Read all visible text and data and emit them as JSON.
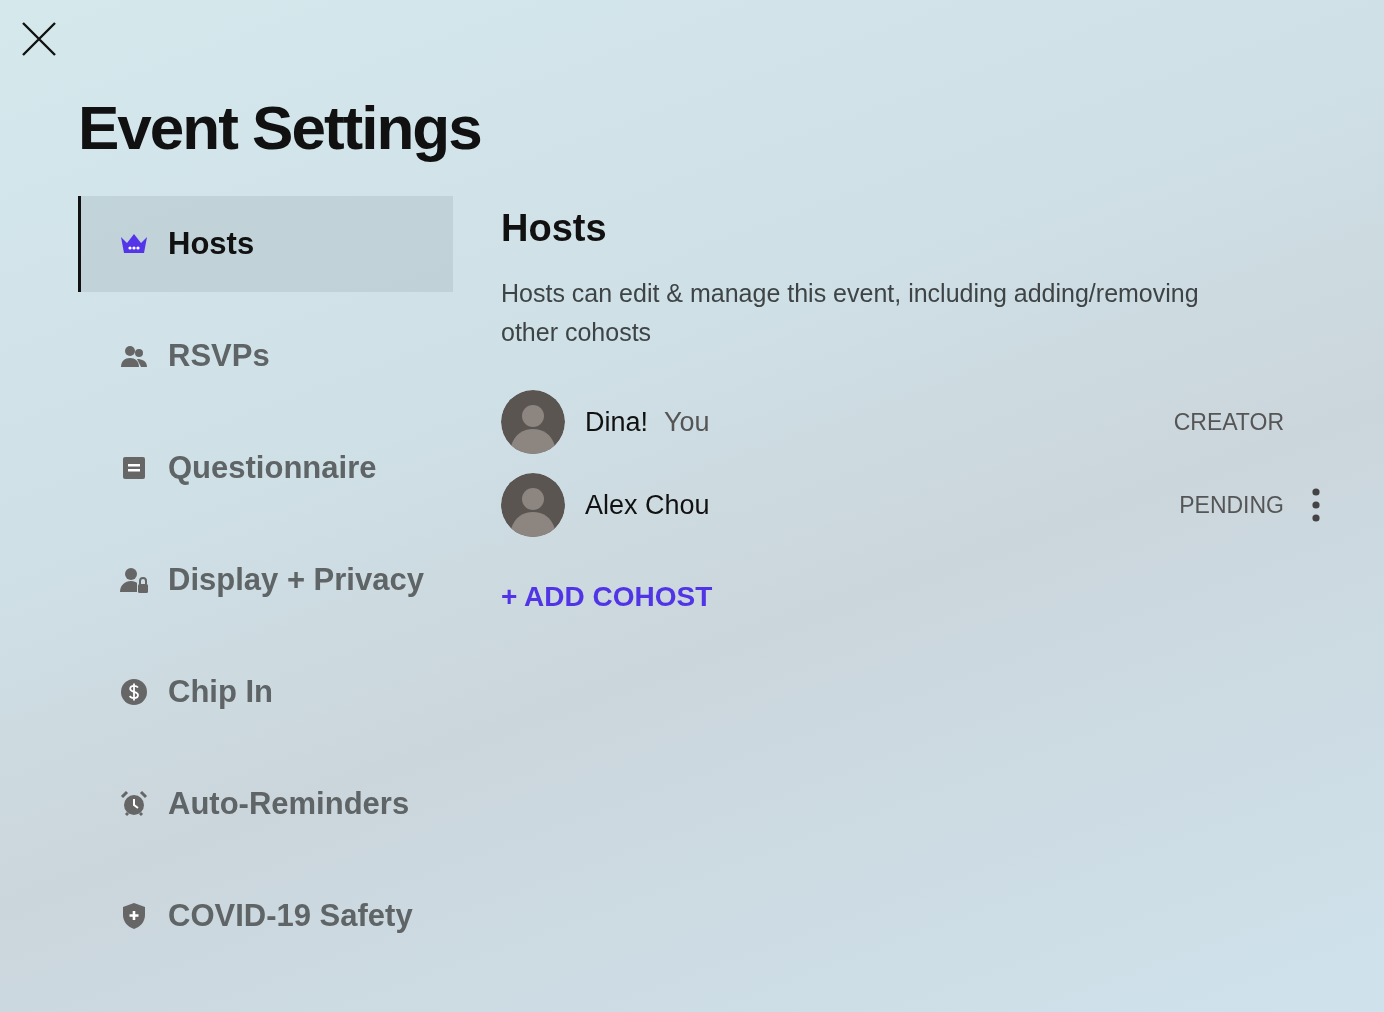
{
  "title": "Event Settings",
  "sidebar": {
    "items": [
      {
        "label": "Hosts",
        "selected": true
      },
      {
        "label": "RSVPs",
        "selected": false
      },
      {
        "label": "Questionnaire",
        "selected": false
      },
      {
        "label": "Display + Privacy",
        "selected": false
      },
      {
        "label": "Chip In",
        "selected": false
      },
      {
        "label": "Auto-Reminders",
        "selected": false
      },
      {
        "label": "COVID-19 Safety",
        "selected": false
      }
    ]
  },
  "section": {
    "heading": "Hosts",
    "description": "Hosts can edit & manage this event, including adding/removing other cohosts",
    "hosts": [
      {
        "name": "Dina!",
        "tag": "You",
        "role": "CREATOR",
        "menu": false
      },
      {
        "name": "Alex Chou",
        "role": "PENDING",
        "menu": true
      }
    ],
    "add_button": "+ ADD COHOST"
  }
}
